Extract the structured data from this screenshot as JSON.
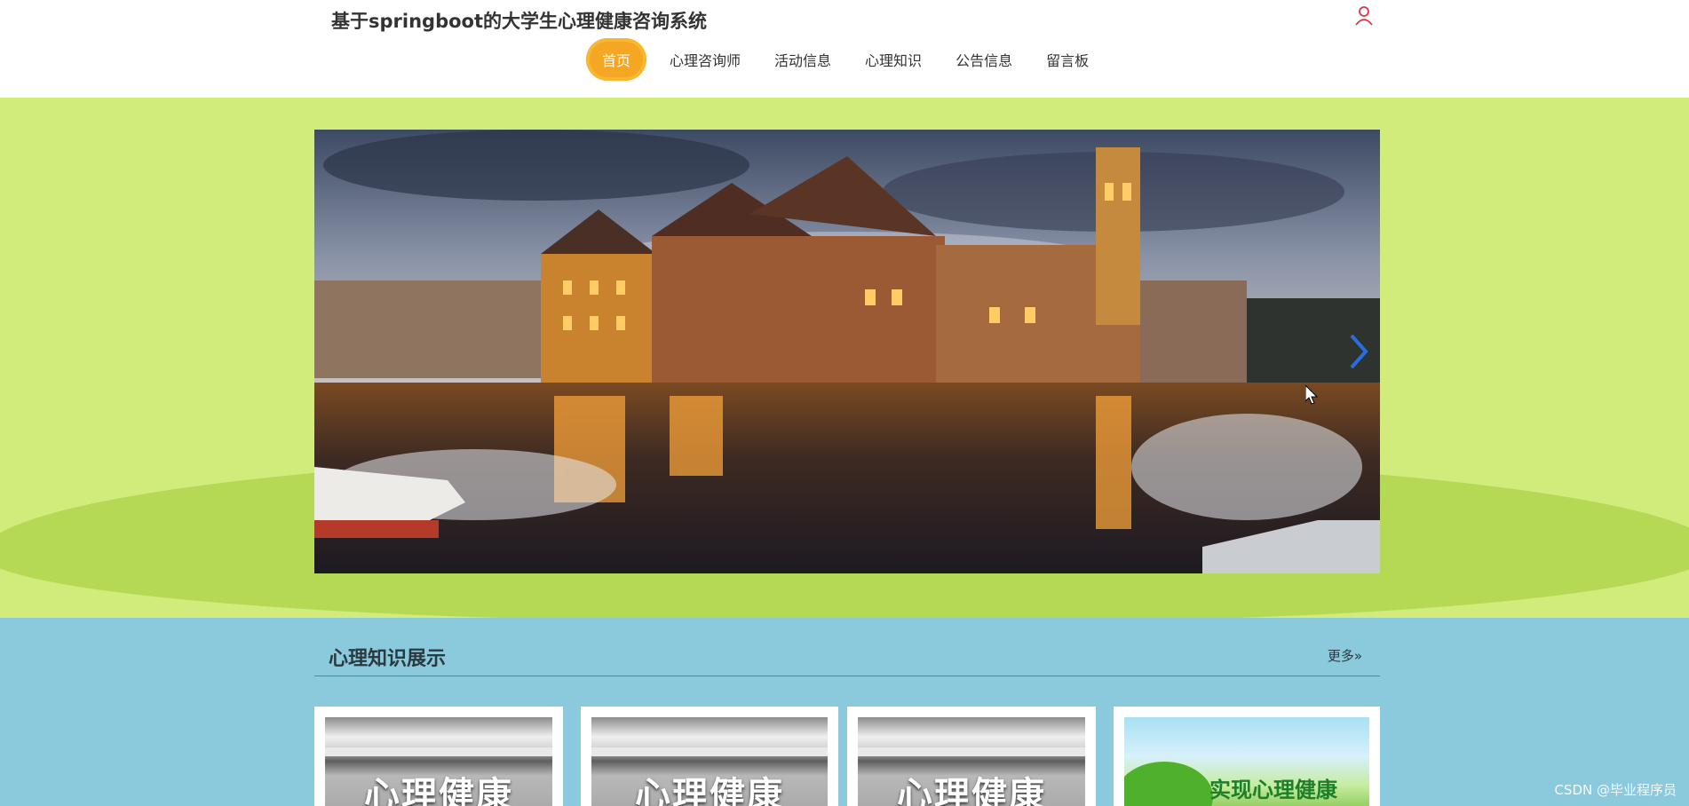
{
  "header": {
    "title": "基于springboot的大学生心理健康咨询系统",
    "user_icon": "user-icon"
  },
  "nav": {
    "items": [
      {
        "label": "首页",
        "active": true
      },
      {
        "label": "心理咨询师"
      },
      {
        "label": "活动信息"
      },
      {
        "label": "心理知识"
      },
      {
        "label": "公告信息"
      },
      {
        "label": "留言板"
      }
    ]
  },
  "banner": {
    "next_icon": "chevron-right-icon",
    "colors": {
      "band": "#d2ec7b",
      "blob": "#b6d955"
    }
  },
  "knowledge": {
    "title": "心理知识展示",
    "more": "更多»",
    "cards": [
      {
        "title": "心理健康"
      },
      {
        "title": "心理健康"
      },
      {
        "title": "心理健康"
      },
      {
        "title": "实现心理健康"
      }
    ]
  },
  "watermark": "CSDN @毕业程序员",
  "colors": {
    "accent": "#f5a623",
    "section_bg": "#8acadc"
  }
}
